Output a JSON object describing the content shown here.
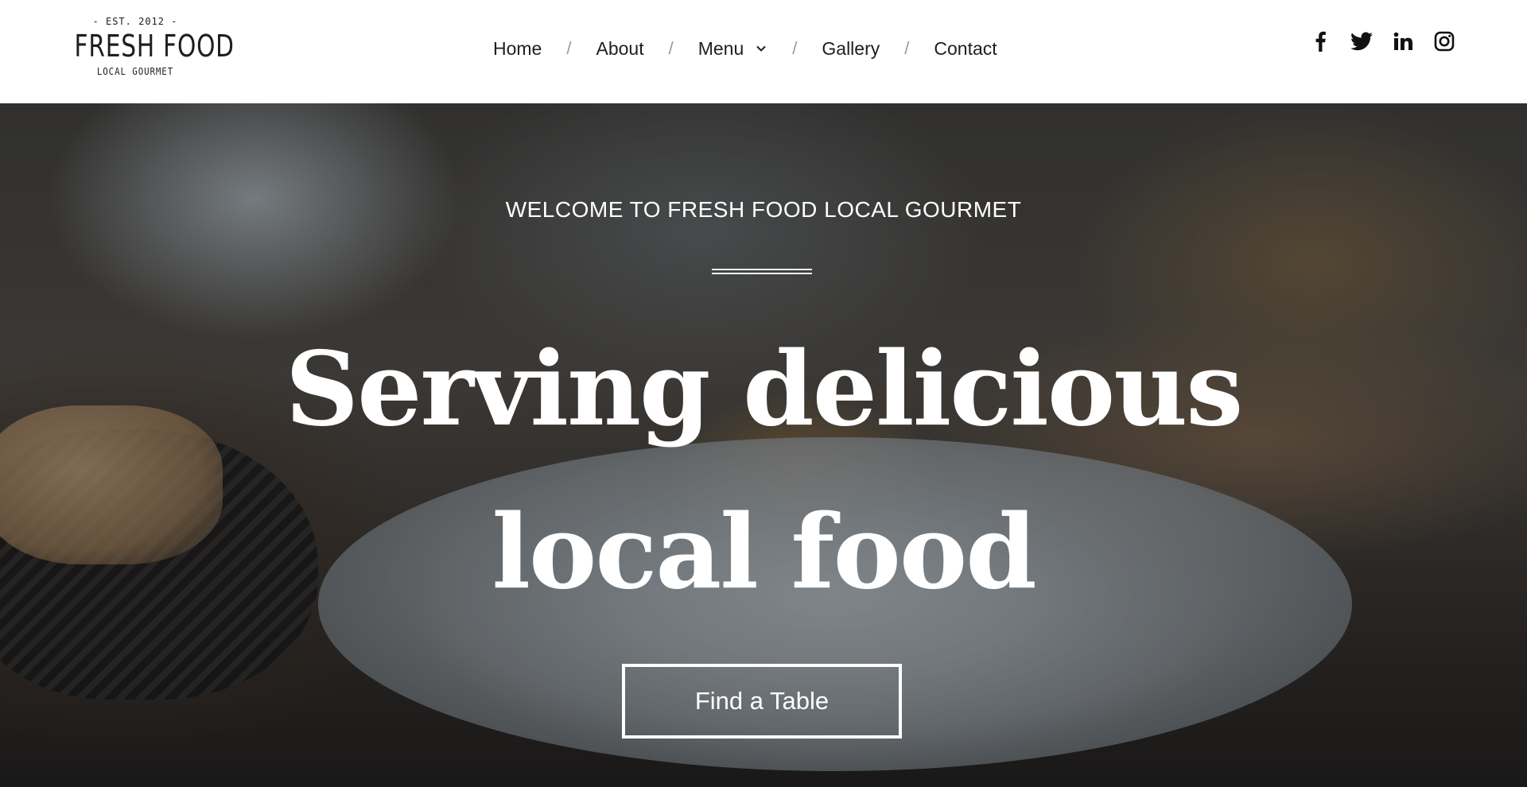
{
  "logo": {
    "est": "- EST. 2012 -",
    "name": "FRESH FOOD",
    "subtitle": "LOCAL GOURMET"
  },
  "nav": {
    "items": [
      {
        "label": "Home"
      },
      {
        "label": "About"
      },
      {
        "label": "Menu",
        "has_dropdown": true
      },
      {
        "label": "Gallery"
      },
      {
        "label": "Contact"
      }
    ],
    "separator": "/"
  },
  "social": [
    "facebook-icon",
    "twitter-icon",
    "linkedin-icon",
    "instagram-icon"
  ],
  "hero": {
    "welcome": "WELCOME TO FRESH FOOD LOCAL GOURMET",
    "headline_line1": "Serving delicious",
    "headline_line2": "local food",
    "cta_label": "Find a Table"
  },
  "colors": {
    "text_dark": "#1f1f1f",
    "separator": "#9a9a9a",
    "hero_text": "#ffffff"
  }
}
